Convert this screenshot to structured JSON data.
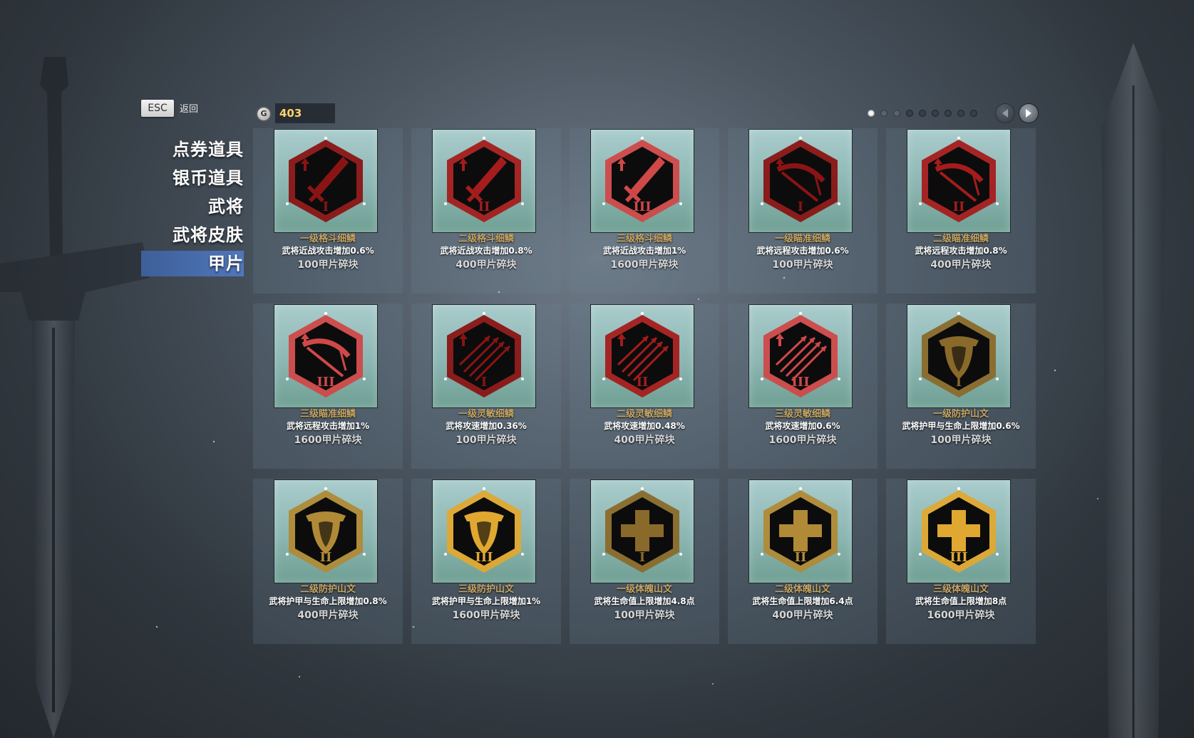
{
  "header": {
    "esc_key": "ESC",
    "back_label": "返回",
    "currency_icon": "G",
    "currency_amount": "403"
  },
  "pagination": {
    "pages": 9,
    "active_index": 0
  },
  "sidebar": {
    "items": [
      {
        "label": "点券道具",
        "active": false
      },
      {
        "label": "银币道具",
        "active": false
      },
      {
        "label": "武将",
        "active": false
      },
      {
        "label": "武将皮肤",
        "active": false
      },
      {
        "label": "甲片",
        "active": true
      }
    ]
  },
  "items": [
    {
      "name": "一级格斗细鳞",
      "desc": "武将近战攻击增加0.6%",
      "cost": "100甲片碎块",
      "icon": "sword-icon",
      "tier": "I",
      "color": "#8a1414"
    },
    {
      "name": "二级格斗细鳞",
      "desc": "武将近战攻击增加0.8%",
      "cost": "400甲片碎块",
      "icon": "sword-icon",
      "tier": "II",
      "color": "#a51c1c"
    },
    {
      "name": "三级格斗细鳞",
      "desc": "武将近战攻击增加1%",
      "cost": "1600甲片碎块",
      "icon": "sword-icon",
      "tier": "III",
      "color": "#d04848"
    },
    {
      "name": "一级瞄准细鳞",
      "desc": "武将远程攻击增加0.6%",
      "cost": "100甲片碎块",
      "icon": "crossbow-icon",
      "tier": "I",
      "color": "#8a1414"
    },
    {
      "name": "二级瞄准细鳞",
      "desc": "武将远程攻击增加0.8%",
      "cost": "400甲片碎块",
      "icon": "crossbow-icon",
      "tier": "II",
      "color": "#a51c1c"
    },
    {
      "name": "三级瞄准细鳞",
      "desc": "武将远程攻击增加1%",
      "cost": "1600甲片碎块",
      "icon": "crossbow-icon",
      "tier": "III",
      "color": "#d04848"
    },
    {
      "name": "一级灵敏细鳞",
      "desc": "武将攻速增加0.36%",
      "cost": "100甲片碎块",
      "icon": "arrows-icon",
      "tier": "I",
      "color": "#8a1414"
    },
    {
      "name": "二级灵敏细鳞",
      "desc": "武将攻速增加0.48%",
      "cost": "400甲片碎块",
      "icon": "arrows-icon",
      "tier": "II",
      "color": "#a51c1c"
    },
    {
      "name": "三级灵敏细鳞",
      "desc": "武将攻速增加0.6%",
      "cost": "1600甲片碎块",
      "icon": "arrows-icon",
      "tier": "III",
      "color": "#d04848"
    },
    {
      "name": "一级防护山文",
      "desc": "武将护甲与生命上限增加0.6%",
      "cost": "100甲片碎块",
      "icon": "shield-icon",
      "tier": "I",
      "color": "#8a6a2a"
    },
    {
      "name": "二级防护山文",
      "desc": "武将护甲与生命上限增加0.8%",
      "cost": "400甲片碎块",
      "icon": "shield-icon",
      "tier": "II",
      "color": "#b08a36"
    },
    {
      "name": "三级防护山文",
      "desc": "武将护甲与生命上限增加1%",
      "cost": "1600甲片碎块",
      "icon": "shield-icon",
      "tier": "III",
      "color": "#e0a830"
    },
    {
      "name": "一级体魄山文",
      "desc": "武将生命值上限增加4.8点",
      "cost": "100甲片碎块",
      "icon": "cross-icon",
      "tier": "I",
      "color": "#8a6a2a"
    },
    {
      "name": "二级体魄山文",
      "desc": "武将生命值上限增加6.4点",
      "cost": "400甲片碎块",
      "icon": "cross-icon",
      "tier": "II",
      "color": "#b08a36"
    },
    {
      "name": "三级体魄山文",
      "desc": "武将生命值上限增加8点",
      "cost": "1600甲片碎块",
      "icon": "cross-icon",
      "tier": "III",
      "color": "#e0a830"
    }
  ]
}
